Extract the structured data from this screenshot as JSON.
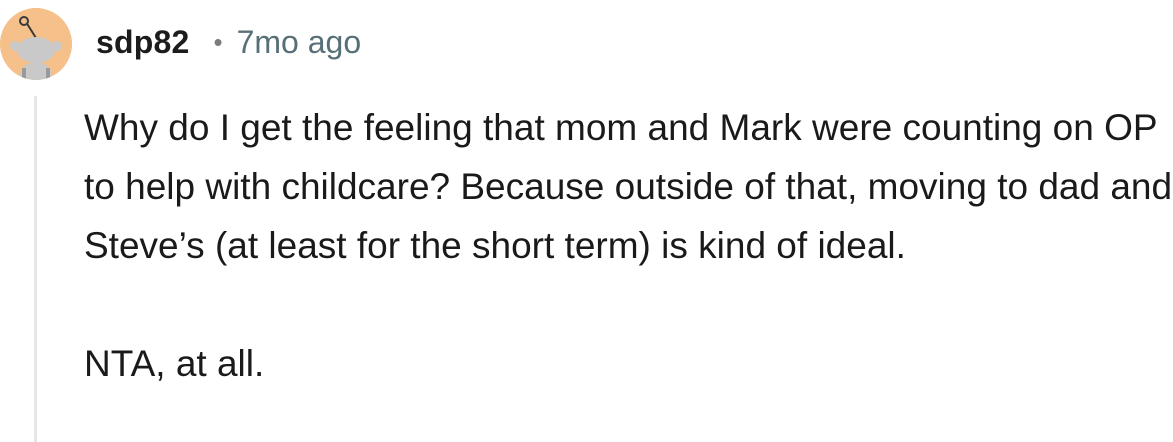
{
  "comment": {
    "author": "sdp82",
    "separator": "•",
    "timestamp": "7mo ago",
    "avatar_icon": "snoo-avatar-icon",
    "avatar_color": "#f6c08a",
    "paragraphs": [
      "Why do I get the feeling that mom and Mark were counting on OP to help with childcare? Because outside of that, moving to dad and Steve’s (at least for the short term) is kind of ideal.",
      "NTA, at all."
    ]
  }
}
